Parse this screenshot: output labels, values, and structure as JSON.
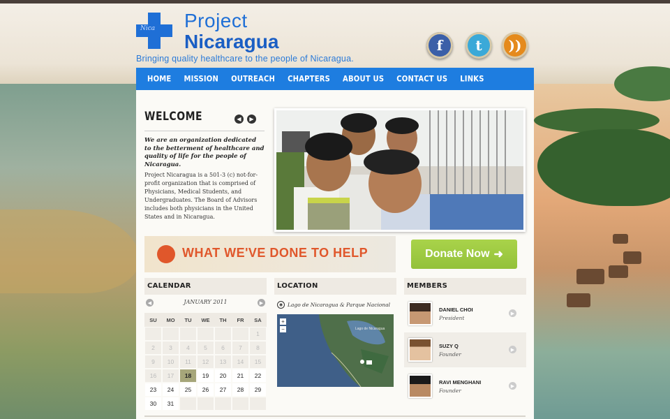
{
  "site": {
    "logo_line1": "Project",
    "logo_line2": "Nicaragua",
    "logo_script": "Nica",
    "tagline": "Bringing quality healthcare to the people of Nicaragua."
  },
  "social": [
    {
      "name": "facebook",
      "glyph": "f",
      "icon": "facebook-icon"
    },
    {
      "name": "twitter",
      "glyph": "t",
      "icon": "twitter-icon"
    },
    {
      "name": "rss",
      "glyph": "))",
      "icon": "rss-icon"
    }
  ],
  "nav": [
    "HOME",
    "MISSION",
    "OUTREACH",
    "CHAPTERS",
    "ABOUT US",
    "CONTACT US",
    "LINKS"
  ],
  "welcome": {
    "title": "WELCOME",
    "intro": "We are an organization dedicated to the betterment of healthcare and quality of life for the people of Nicaragua.",
    "body": "Project Nicaragua is a 501-3 (c) not-for-profit organization that is comprised of Physicians, Medical Students, and Undergraduates. The Board of Advisors includes both physicians in the United States and in Nicaragua."
  },
  "banner": {
    "help_text": "WHAT WE'VE DONE TO HELP",
    "donate_label": "Donate Now",
    "donate_arrow": "➜"
  },
  "calendar": {
    "title": "CALENDAR",
    "month": "JANUARY 2011",
    "days": [
      "SU",
      "MO",
      "TU",
      "WE",
      "TH",
      "FR",
      "SA"
    ],
    "weeks": [
      [
        "",
        "",
        "",
        "",
        "",
        "",
        "1"
      ],
      [
        "2",
        "3",
        "4",
        "5",
        "6",
        "7",
        "8"
      ],
      [
        "9",
        "10",
        "11",
        "12",
        "13",
        "14",
        "15"
      ],
      [
        "16",
        "17",
        "18",
        "19",
        "20",
        "21",
        "22"
      ],
      [
        "23",
        "24",
        "25",
        "26",
        "27",
        "28",
        "29"
      ],
      [
        "30",
        "31",
        "",
        "",
        "",
        "",
        ""
      ]
    ],
    "today": "18"
  },
  "location": {
    "title": "LOCATION",
    "place": "Lago de Nicaragua & Parque Nacional",
    "map_label": "Lago de Nicaragua"
  },
  "members": {
    "title": "MEMBERS",
    "list": [
      {
        "name": "DANIEL CHOI",
        "role": "President"
      },
      {
        "name": "SUZY Q",
        "role": "Founder"
      },
      {
        "name": "RAVI MENGHANI",
        "role": "Founder"
      }
    ]
  },
  "colors": {
    "brand_blue": "#1f6fd6",
    "nav_blue": "#1e7de0",
    "donate_green": "#a9d34a",
    "help_orange": "#e0572b"
  }
}
